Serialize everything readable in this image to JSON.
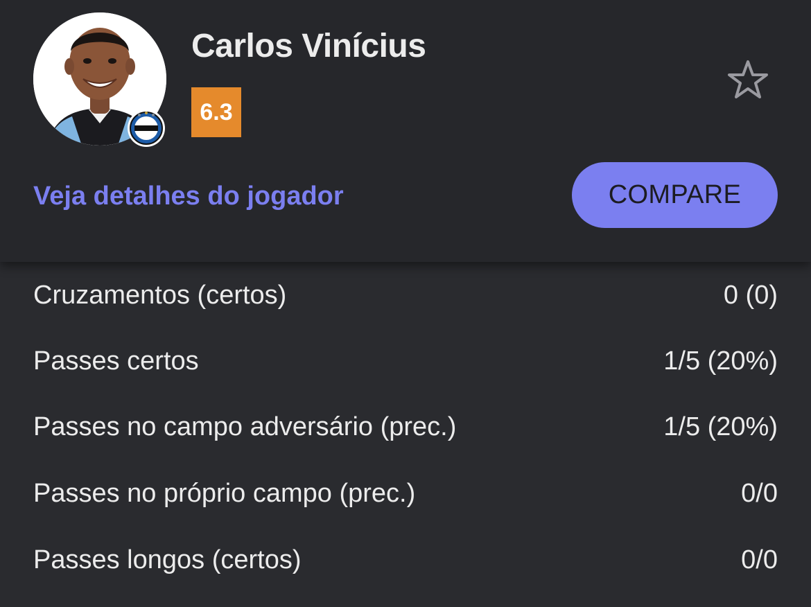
{
  "player": {
    "name": "Carlos Vinícius",
    "rating": "6.3",
    "club_badge_text": "GRÊMIO"
  },
  "actions": {
    "details_link": "Veja detalhes do jogador",
    "compare_label": "COMPARE"
  },
  "stats": [
    {
      "label": "Cruzamentos (certos)",
      "value": "0 (0)"
    },
    {
      "label": "Passes certos",
      "value": "1/5 (20%)"
    },
    {
      "label": "Passes no campo adversário (prec.)",
      "value": "1/5 (20%)"
    },
    {
      "label": "Passes no próprio campo (prec.)",
      "value": "0/0"
    },
    {
      "label": "Passes longos (certos)",
      "value": "0/0"
    }
  ],
  "colors": {
    "background": "#26272b",
    "accent": "#7b7ff0",
    "rating": "#e58a2c"
  },
  "icons": {
    "favorite": "star-outline-icon"
  }
}
